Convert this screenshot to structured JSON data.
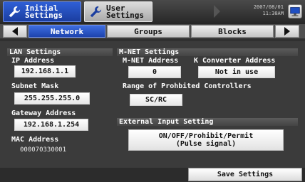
{
  "header": {
    "tab_initial_label": "Initial\nSettings",
    "tab_user_label": "User\nSettings",
    "date": "2007/08/01",
    "time": "11:30AM"
  },
  "tabs": {
    "network": "Network",
    "groups": "Groups",
    "blocks": "Blocks"
  },
  "lan": {
    "title": "LAN Settings",
    "ip_label": "IP Address",
    "ip_value": "192.168.1.1",
    "subnet_label": "Subnet Mask",
    "subnet_value": "255.255.255.0",
    "gateway_label": "Gateway Address",
    "gateway_value": "192.168.1.254",
    "mac_label": "MAC Address",
    "mac_value": "000070330001"
  },
  "mnet": {
    "title": "M-NET Settings",
    "address_label": "M-NET Address",
    "address_value": "0",
    "kconv_label": "K Converter Address",
    "kconv_value": "Not in use",
    "range_label": "Range of Prohbited Controllers",
    "range_value": "SC/RC"
  },
  "external": {
    "title": "External Input Setting",
    "value_line1": "ON/OFF/Prohibit/Permit",
    "value_line2": "(Pulse signal)"
  },
  "footer": {
    "save_label": "Save Settings"
  },
  "colors": {
    "active_tab": "#2a52c4",
    "background": "#3b3b3b"
  },
  "icons": [
    "wrench-icon",
    "wrench-icon",
    "arrow-right-icon",
    "monitor-icon",
    "arrow-left-icon",
    "arrow-right-icon"
  ]
}
